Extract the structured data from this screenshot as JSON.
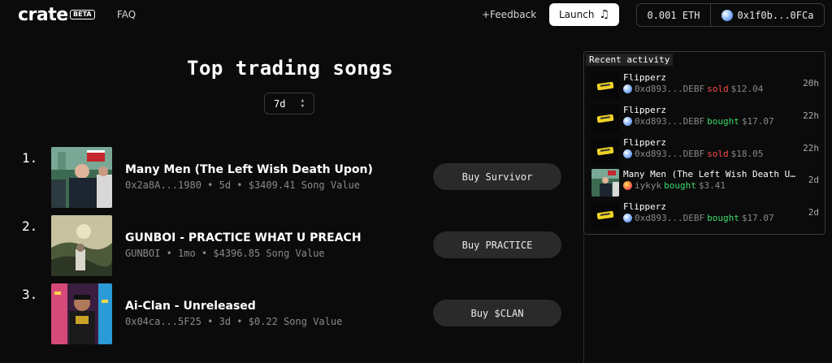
{
  "header": {
    "logo": "crate",
    "beta": "BETA",
    "faq": "FAQ",
    "feedback": "+Feedback",
    "launch": "Launch",
    "launch_icon": "music-notes-icon",
    "balance": "0.001 ETH",
    "address": "0x1f0b...0FCa"
  },
  "main": {
    "title": "Top trading songs",
    "period": "7d",
    "songs": [
      {
        "rank": "1.",
        "name": "Many Men (The Left Wish Death Upon)",
        "meta": "0x2a8A...1980 • 5d • $3409.41 Song Value",
        "buy": "Buy Survivor"
      },
      {
        "rank": "2.",
        "name": "GUNBOI - PRACTICE WHAT U PREACH",
        "meta": "GUNBOI • 1mo • $4396.85 Song Value",
        "buy": "Buy PRACTICE"
      },
      {
        "rank": "3.",
        "name": "Ai-Clan - Unreleased",
        "meta": "0x04ca...5F25 • 3d • $0.22 Song Value",
        "buy": "Buy $CLAN"
      }
    ]
  },
  "activity": {
    "title": "Recent activity",
    "items": [
      {
        "name": "Flipperz",
        "who": "0xd893...DEBF",
        "action": "sold",
        "price": "$12.04",
        "time": "20h"
      },
      {
        "name": "Flipperz",
        "who": "0xd893...DEBF",
        "action": "bought",
        "price": "$17.07",
        "time": "22h"
      },
      {
        "name": "Flipperz",
        "who": "0xd893...DEBF",
        "action": "sold",
        "price": "$18.05",
        "time": "22h"
      },
      {
        "name": "Many Men (The Left Wish Death Upon)",
        "who": "iykyk",
        "action": "bought",
        "price": "$3.41",
        "time": "2d"
      },
      {
        "name": "Flipperz",
        "who": "0xd893...DEBF",
        "action": "bought",
        "price": "$17.07",
        "time": "2d"
      }
    ]
  },
  "colors": {
    "background": "#0b0b0b",
    "sold": "#ff4d4d",
    "bought": "#3ddc6b",
    "button": "#2a2a2a"
  }
}
